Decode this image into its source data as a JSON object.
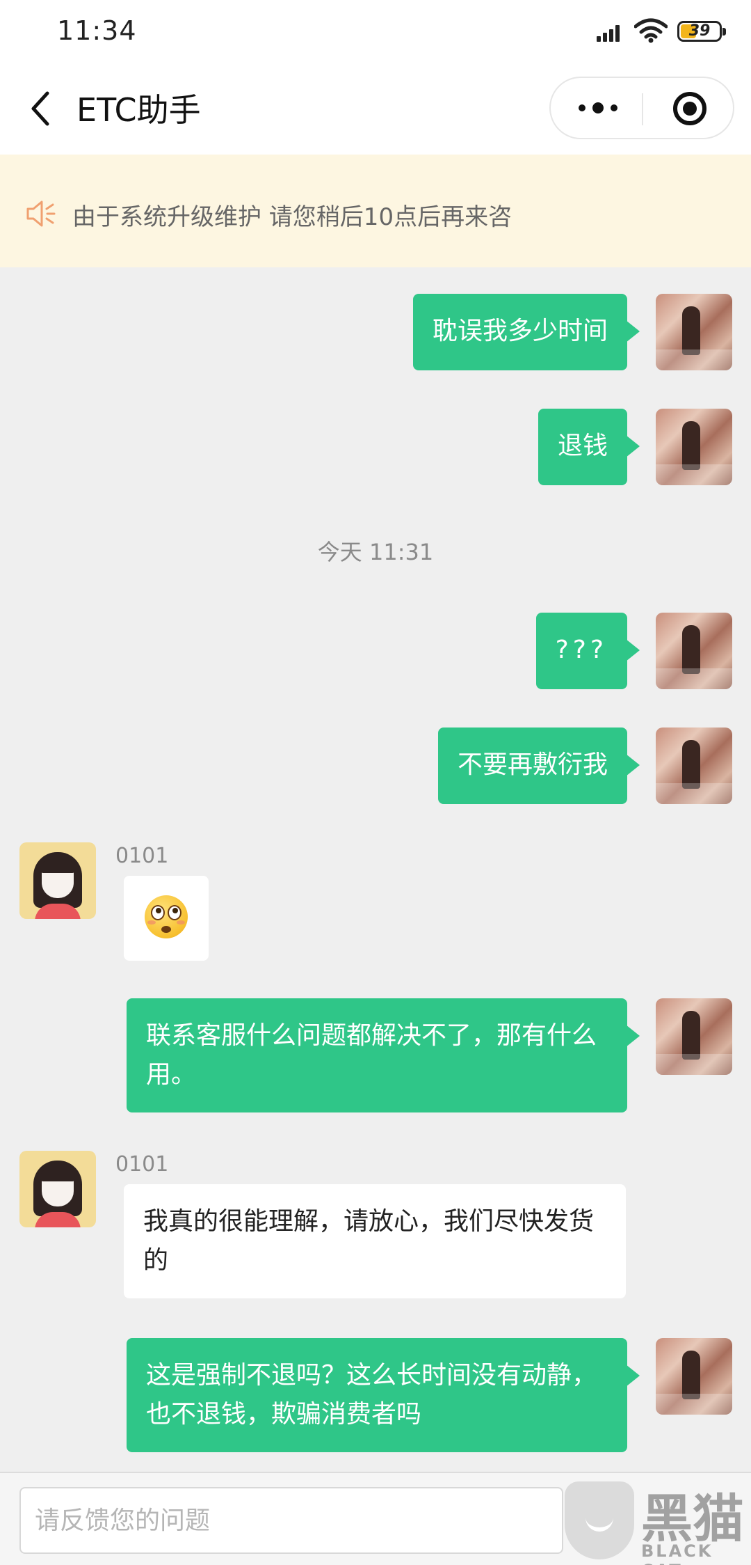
{
  "status_bar": {
    "time": "11:34",
    "battery_level": "39",
    "icons": [
      "signal-icon",
      "wifi-icon",
      "battery-icon"
    ]
  },
  "header": {
    "title": "ETC助手",
    "icons": [
      "back-icon",
      "more-icon",
      "close-miniprogram-icon"
    ]
  },
  "notice": {
    "text": "由于系统升级维护 请您稍后10点后再来咨",
    "icon": "speaker-icon",
    "color": "#fdf6e1"
  },
  "chat": {
    "timestamp": "今天 11:31",
    "agent_name": "0101",
    "messages": [
      {
        "from": "me",
        "text": "耽误我多少时间"
      },
      {
        "from": "me",
        "text": "退钱"
      },
      {
        "from": "me",
        "text": "???"
      },
      {
        "from": "me",
        "text": "不要再敷衍我"
      },
      {
        "from": "agent",
        "name": "0101",
        "emoji": "flushed-face-emoji"
      },
      {
        "from": "me",
        "text": "联系客服什么问题都解决不了，那有什么用。"
      },
      {
        "from": "agent",
        "name": "0101",
        "text": "我真的很能理解，请放心，我们尽快发货的"
      },
      {
        "from": "me",
        "text": "这是强制不退吗？这么长时间没有动静，也不退钱，欺骗消费者吗"
      }
    ]
  },
  "input": {
    "placeholder": "请反馈您的问题",
    "value": ""
  },
  "watermark": {
    "cn": "黑猫",
    "en": "BLACK CAT"
  },
  "colors": {
    "my_bubble": "#2fc688",
    "background": "#efefef"
  }
}
